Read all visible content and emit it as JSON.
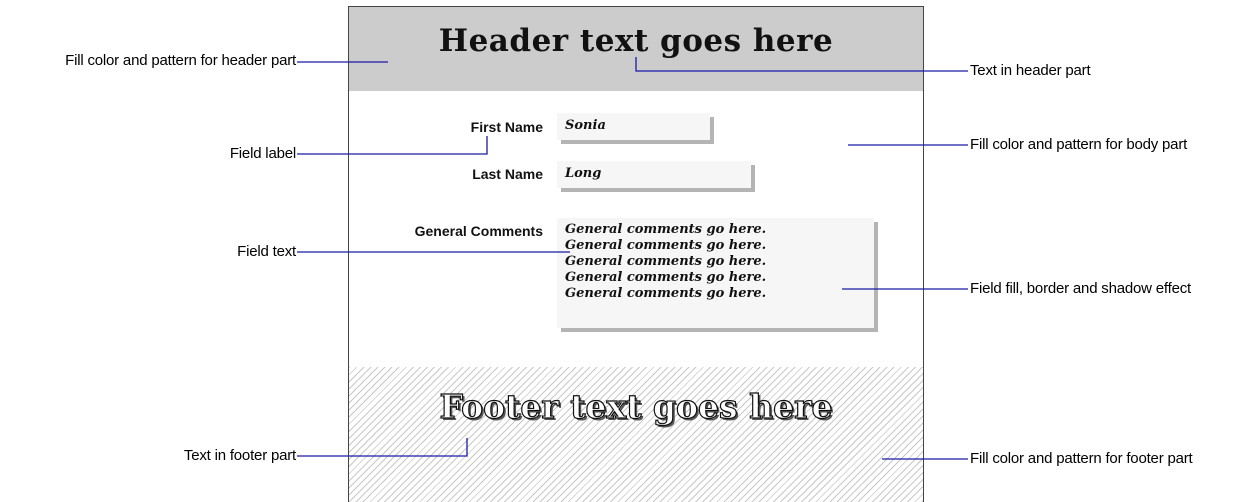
{
  "callouts": {
    "header_fill": "Fill color and pattern for header part",
    "header_text": "Text in header part",
    "field_label": "Field label",
    "body_fill": "Fill color and pattern for body part",
    "field_text": "Field text",
    "field_effect": "Field fill, border and shadow effect",
    "footer_text": "Text in footer part",
    "footer_fill": "Fill color and pattern for footer part"
  },
  "layout_sample": {
    "header_text": "Header text goes here",
    "footer_text": "Footer text goes here",
    "fields": {
      "first_name": {
        "label": "First Name",
        "value": "Sonia"
      },
      "last_name": {
        "label": "Last Name",
        "value": "Long"
      },
      "general_comments": {
        "label": "General Comments",
        "lines": [
          "General comments go here.",
          "General comments go here.",
          "General comments go here.",
          "General comments go here.",
          "General comments go here."
        ]
      }
    }
  },
  "colors": {
    "leader_line": "#1a1aa8",
    "header_fill": "#cccccc",
    "footer_hatch": "#c8c8c8",
    "field_fill": "#f6f6f6",
    "field_shadow": "#b4b4b4"
  }
}
